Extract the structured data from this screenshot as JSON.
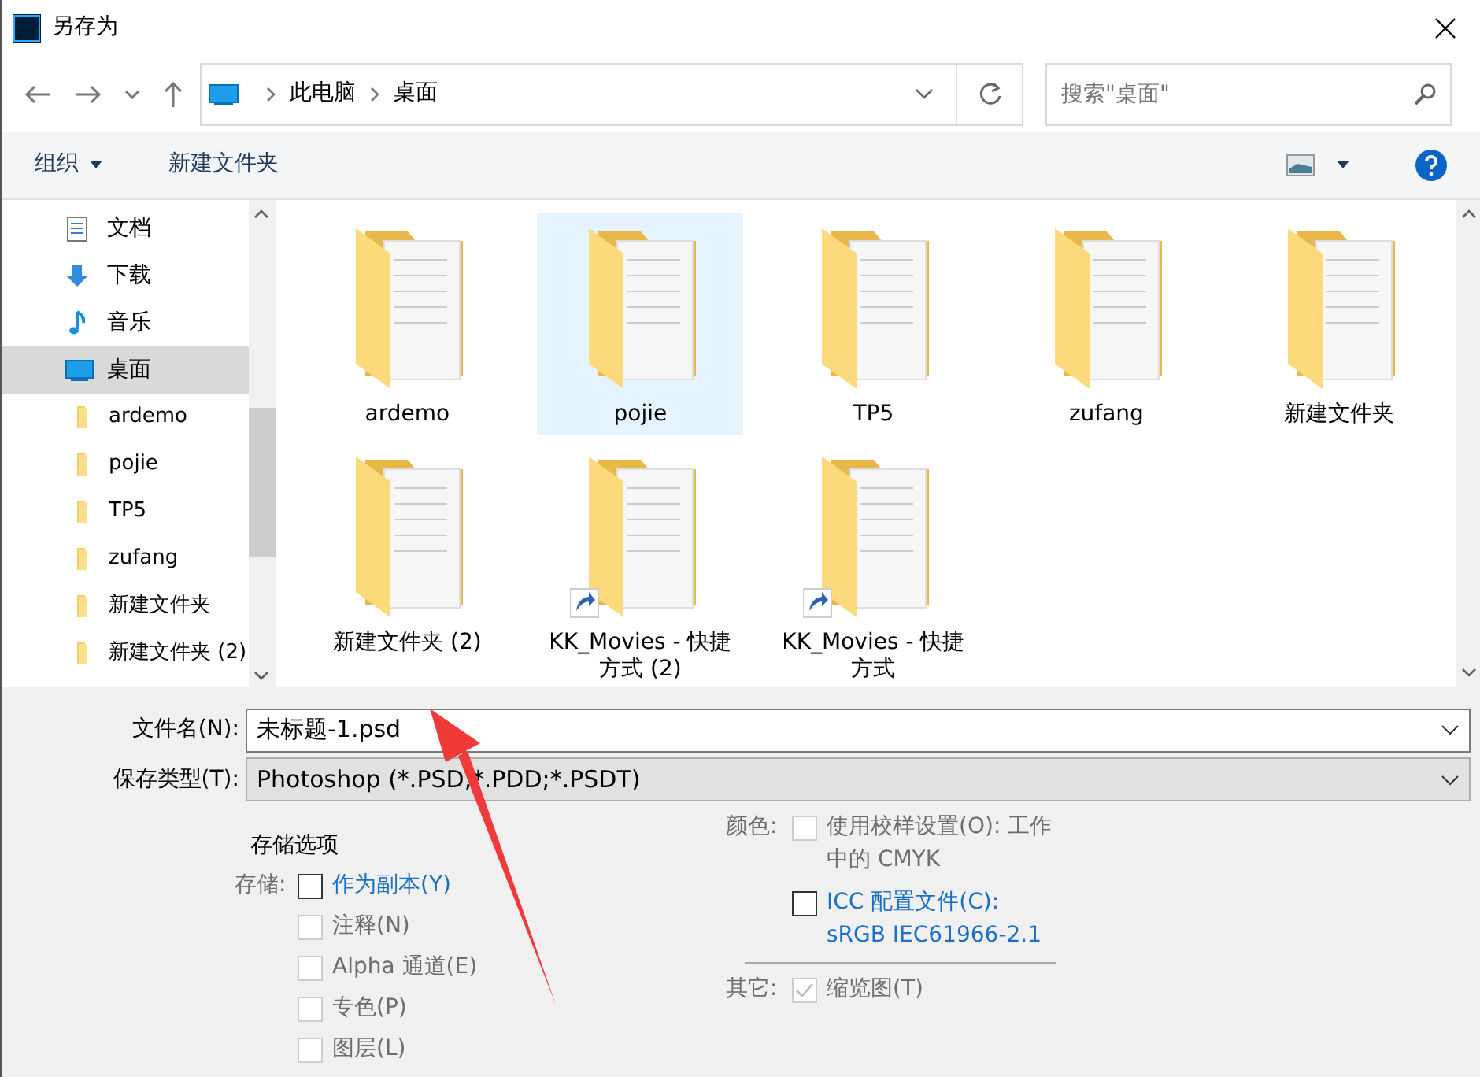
{
  "window": {
    "title": "另存为"
  },
  "address": {
    "segments": [
      "此电脑",
      "桌面"
    ],
    "search_placeholder": "搜索\"桌面\""
  },
  "toolbar": {
    "organize": "组织",
    "new_folder": "新建文件夹"
  },
  "sidebar": {
    "items": [
      {
        "label": "文档",
        "kind": "document",
        "selected": false
      },
      {
        "label": "下载",
        "kind": "download",
        "selected": false
      },
      {
        "label": "音乐",
        "kind": "music",
        "selected": false
      },
      {
        "label": "桌面",
        "kind": "desktop",
        "selected": true,
        "children": [
          {
            "label": "ardemo",
            "kind": "folder",
            "selected": false
          },
          {
            "label": "pojie",
            "kind": "folder",
            "selected": false
          },
          {
            "label": "TP5",
            "kind": "folder",
            "selected": false
          },
          {
            "label": "zufang",
            "kind": "folder",
            "selected": false
          },
          {
            "label": "新建文件夹",
            "kind": "folder",
            "selected": false
          },
          {
            "label": "新建文件夹 (2)",
            "kind": "folder",
            "selected": false
          }
        ]
      }
    ]
  },
  "files": [
    {
      "name": "ardemo",
      "kind": "folder",
      "selected": false
    },
    {
      "name": "pojie",
      "kind": "folder",
      "selected": true
    },
    {
      "name": "TP5",
      "kind": "folder",
      "selected": false
    },
    {
      "name": "zufang",
      "kind": "folder",
      "selected": false
    },
    {
      "name": "新建文件夹",
      "kind": "folder",
      "selected": false
    },
    {
      "name": "新建文件夹 (2)",
      "kind": "folder",
      "selected": false
    },
    {
      "name": "KK_Movies - 快捷方式 (2)",
      "kind": "shortcut",
      "selected": false
    },
    {
      "name": "KK_Movies - 快捷方式",
      "kind": "shortcut",
      "selected": false
    }
  ],
  "form": {
    "filename_label": "文件名(N):",
    "filename": "未标题-1.psd",
    "type_label": "保存类型(T):",
    "type": "Photoshop (*.PSD;*.PDD;*.PSDT)"
  },
  "options": {
    "title": "存储选项",
    "save_label": "存储:",
    "save_options": [
      {
        "label": "作为副本(Y)",
        "checked": false,
        "disabled": false
      },
      {
        "label": "注释(N)",
        "checked": false,
        "disabled": true
      },
      {
        "label": "Alpha 通道(E)",
        "checked": false,
        "disabled": true
      },
      {
        "label": "专色(P)",
        "checked": false,
        "disabled": true
      },
      {
        "label": "图层(L)",
        "checked": false,
        "disabled": true
      }
    ],
    "color_label": "颜色:",
    "color_options": [
      {
        "label": "使用校样设置(O):  工作中的 CMYK",
        "checked": false,
        "disabled": true
      },
      {
        "label": "ICC 配置文件(C): sRGB IEC61966-2.1",
        "checked": false,
        "disabled": false
      }
    ],
    "other_label": "其它:",
    "other_options": [
      {
        "label": "缩览图(T)",
        "checked": true,
        "disabled": true
      }
    ]
  }
}
